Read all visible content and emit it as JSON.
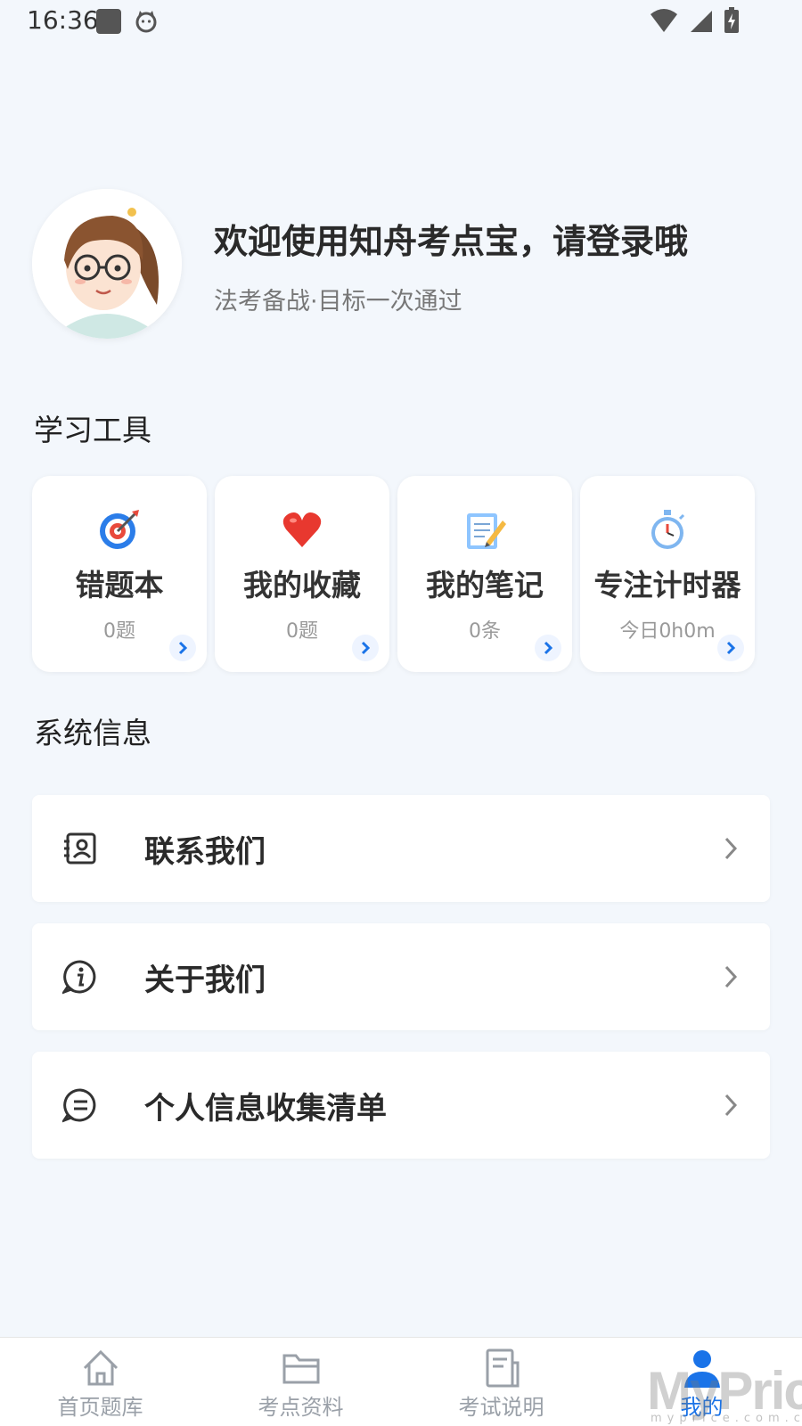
{
  "status_bar": {
    "time": "16:36",
    "icons": [
      "notification-square-icon",
      "cat-icon",
      "wifi-icon",
      "signal-icon",
      "battery-charging-icon"
    ]
  },
  "profile": {
    "welcome": "欢迎使用知舟考点宝，请登录哦",
    "slogan": "法考备战·目标一次通过"
  },
  "tools_section": {
    "title": "学习工具",
    "items": [
      {
        "icon": "target-icon",
        "title": "错题本",
        "count": "0题"
      },
      {
        "icon": "heart-icon",
        "title": "我的收藏",
        "count": "0题"
      },
      {
        "icon": "notepad-icon",
        "title": "我的笔记",
        "count": "0条"
      },
      {
        "icon": "stopwatch-icon",
        "title": "专注计时器",
        "count": "今日0h0m"
      }
    ]
  },
  "system_section": {
    "title": "系统信息",
    "items": [
      {
        "icon": "contact-card-icon",
        "label": "联系我们"
      },
      {
        "icon": "info-icon",
        "label": "关于我们"
      },
      {
        "icon": "chat-bubble-icon",
        "label": "个人信息收集清单"
      }
    ]
  },
  "tabbar": {
    "items": [
      {
        "icon": "home-icon",
        "label": "首页题库",
        "active": false
      },
      {
        "icon": "folder-icon",
        "label": "考点资料",
        "active": false
      },
      {
        "icon": "document-icon",
        "label": "考试说明",
        "active": false
      },
      {
        "icon": "user-icon",
        "label": "我的",
        "active": true
      }
    ]
  },
  "watermark": {
    "text": "MyPrice",
    "sub": "myprice.com.cn"
  },
  "colors": {
    "background": "#f3f7fc",
    "accent": "#1a73e8",
    "card": "#ffffff",
    "muted_text": "#999999"
  }
}
